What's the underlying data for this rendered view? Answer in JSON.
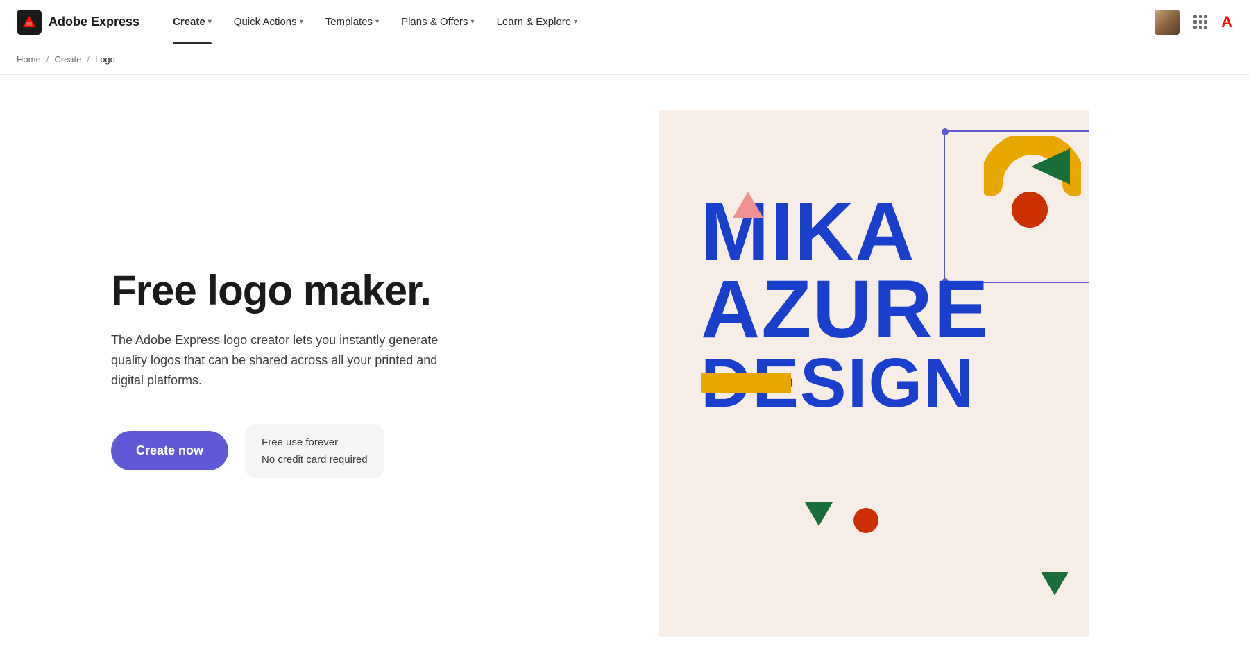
{
  "brand": {
    "name": "Adobe Express"
  },
  "nav": {
    "items": [
      {
        "label": "Create",
        "active": true,
        "has_dropdown": true
      },
      {
        "label": "Quick Actions",
        "active": false,
        "has_dropdown": true
      },
      {
        "label": "Templates",
        "active": false,
        "has_dropdown": true
      },
      {
        "label": "Plans & Offers",
        "active": false,
        "has_dropdown": true
      },
      {
        "label": "Learn & Explore",
        "active": false,
        "has_dropdown": true
      }
    ]
  },
  "breadcrumb": {
    "home": "Home",
    "create": "Create",
    "current": "Logo",
    "sep": "/"
  },
  "hero": {
    "title": "Free logo maker.",
    "description": "The Adobe Express logo creator lets you instantly generate quality logos that can be shared across all your printed and digital platforms.",
    "cta_label": "Create now",
    "free_line1": "Free use forever",
    "free_line2": "No credit card required"
  },
  "preview": {
    "alt": "Logo preview - Mika Azure Design"
  }
}
